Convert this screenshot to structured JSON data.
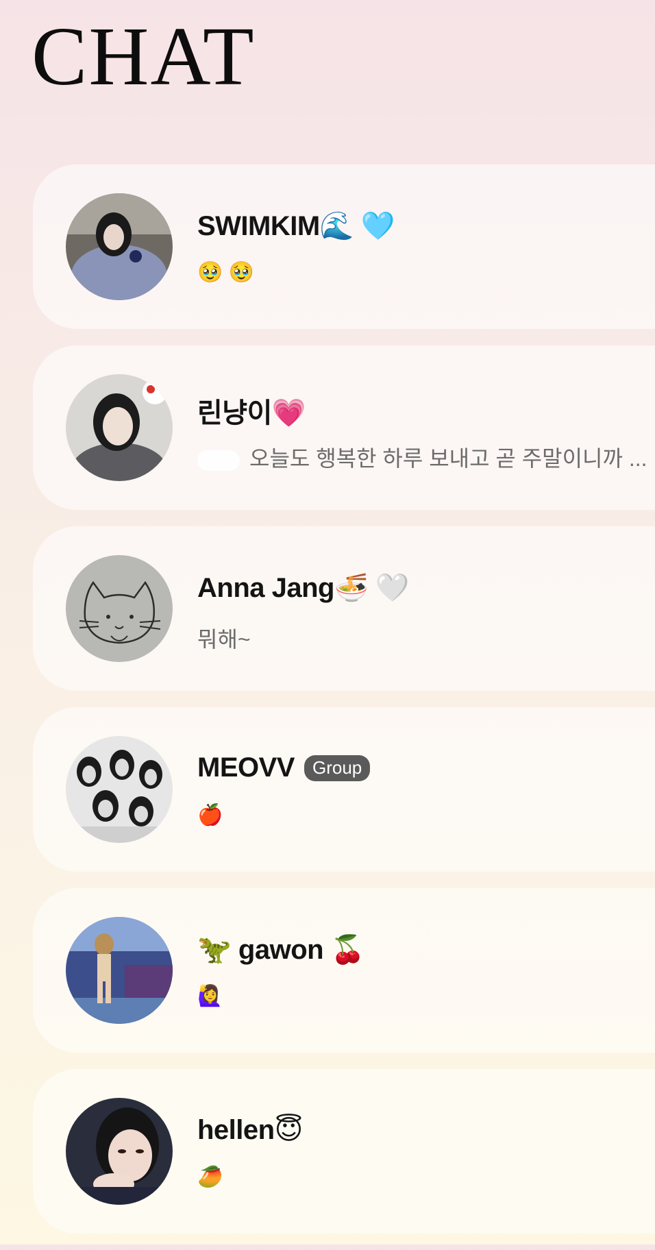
{
  "header": {
    "title": "CHAT"
  },
  "chats": [
    {
      "name": "SWIMKIM🌊 🩵",
      "preview": "🥹 🥹",
      "badge": ""
    },
    {
      "name": "린냥이💗",
      "preview": "오늘도 행복한 하루 보내고 곧 주말이니까 ...",
      "badge": ""
    },
    {
      "name": "Anna Jang🍜 🤍",
      "preview": "뭐해~",
      "badge": ""
    },
    {
      "name": "MEOVV",
      "preview": "🍎",
      "badge": "Group"
    },
    {
      "name": "🦖 gawon 🍒",
      "preview": "🙋‍♀️",
      "badge": ""
    },
    {
      "name": "hellen😇",
      "preview": "🥭",
      "badge": ""
    }
  ],
  "colors": {
    "background_top": "#f6e3e7",
    "background_bottom": "#fdf7e3",
    "badge": "#5a5a5a",
    "preview_text": "#6b6b6b"
  }
}
